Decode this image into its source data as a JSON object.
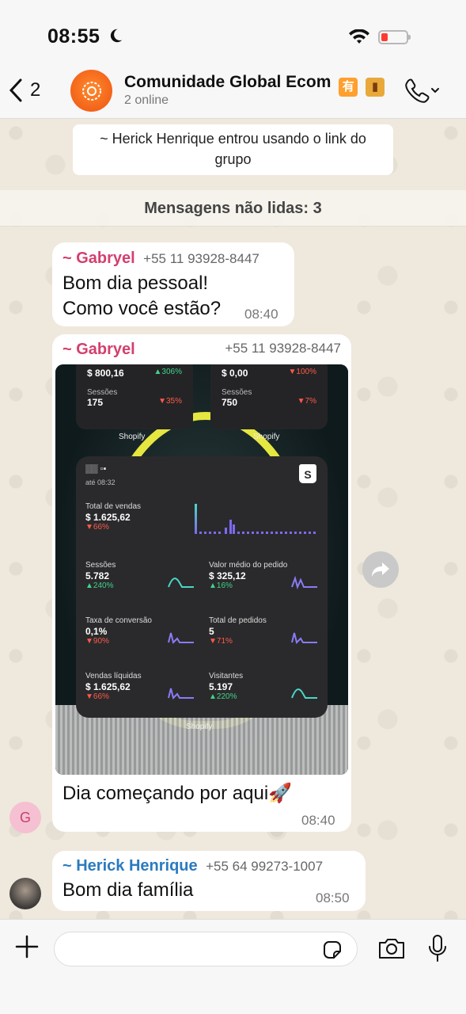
{
  "status_bar": {
    "time": "08:55"
  },
  "header": {
    "back_count": "2",
    "group_name": "Comunidade Global Ecom",
    "badge1": "有",
    "subtitle": "2 online"
  },
  "system_message": "~ Herick Henrique entrou usando o link do grupo",
  "unread_label": "Mensagens não lidas: 3",
  "messages": [
    {
      "sender": "~ Gabryel",
      "phone": "+55 11 93928-8447",
      "line1": "Bom dia pessoal!",
      "line2": "Como você estão?",
      "time": "08:40"
    },
    {
      "sender": "~ Gabryel",
      "phone": "+55 11 93928-8447",
      "caption": "Dia começando por aqui🚀",
      "time": "08:40",
      "avatar_initial": "G"
    },
    {
      "sender": "~ Herick Henrique",
      "phone": "+55 64 99273-1007",
      "text": "Bom dia família",
      "time": "08:50"
    }
  ],
  "screenshot": {
    "card_left": {
      "value": "$ 800,16",
      "pct": "306%",
      "sessions_label": "Sessões",
      "sessions": "175",
      "sessions_pct": "35%"
    },
    "card_right": {
      "value": "$ 0,00",
      "pct": "100%",
      "sessions_label": "Sessões",
      "sessions": "750",
      "sessions_pct": "7%"
    },
    "shopify_label": "Shopify",
    "widget_time": "até 08:32",
    "metrics": {
      "total_vendas": {
        "label": "Total de vendas",
        "value": "$ 1.625,62",
        "pct": "66%"
      },
      "sessoes": {
        "label": "Sessões",
        "value": "5.782",
        "pct": "240%"
      },
      "valor_medio": {
        "label": "Valor médio do pedido",
        "value": "$ 325,12",
        "pct": "16%"
      },
      "taxa_conversao": {
        "label": "Taxa de conversão",
        "value": "0,1%",
        "pct": "90%"
      },
      "total_pedidos": {
        "label": "Total de pedidos",
        "value": "5",
        "pct": "71%"
      },
      "vendas_liquidas": {
        "label": "Vendas líquidas",
        "value": "$ 1.625,62",
        "pct": "66%"
      },
      "visitantes": {
        "label": "Visitantes",
        "value": "5.197",
        "pct": "220%"
      }
    }
  },
  "input": {
    "placeholder": ""
  },
  "colors": {
    "sender_pink": "#d43f6d",
    "sender_blue": "#2b7bbf",
    "accent_orange": "#f3631a"
  }
}
